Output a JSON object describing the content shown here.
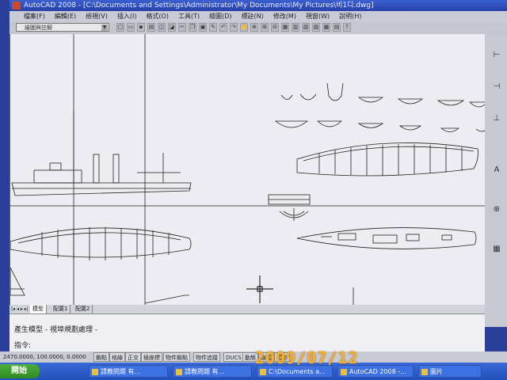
{
  "window": {
    "title": "AutoCAD 2008 - [C:\\Documents and Settings\\Administrator\\My Documents\\My Pictures\\비1디.dwg]"
  },
  "menu": [
    "檔案(F)",
    "編輯(E)",
    "檢視(V)",
    "插入(I)",
    "格式(O)",
    "工具(T)",
    "繪圖(D)",
    "標註(N)",
    "修改(M)",
    "視窗(W)",
    "說明(H)"
  ],
  "toolbar": {
    "layer_select": "繪圖與註解"
  },
  "layout_tabs": {
    "nav": "|◂ ◂ ▸ ▸|",
    "items": [
      "模型",
      "配置1",
      "配置2"
    ]
  },
  "command": {
    "line1": "產生模型 - 視埠規劃處理 -",
    "line2": "指令:"
  },
  "status": {
    "coords": "2470.0000, 100.0000, 0.0000",
    "buttons": [
      "鎖點",
      "格線",
      "正交",
      "極座標",
      "物件鎖點",
      "物件追蹤",
      "DUCS",
      "動態",
      "線寬",
      "模型"
    ]
  },
  "taskbar": {
    "start": "開始",
    "tasks": [
      "請教問題 有...",
      "請教問題 有...",
      "C:\\Documents a...",
      "AutoCAD 2008 -...",
      "圖片"
    ]
  },
  "photo_stamp": "2009/07/12"
}
